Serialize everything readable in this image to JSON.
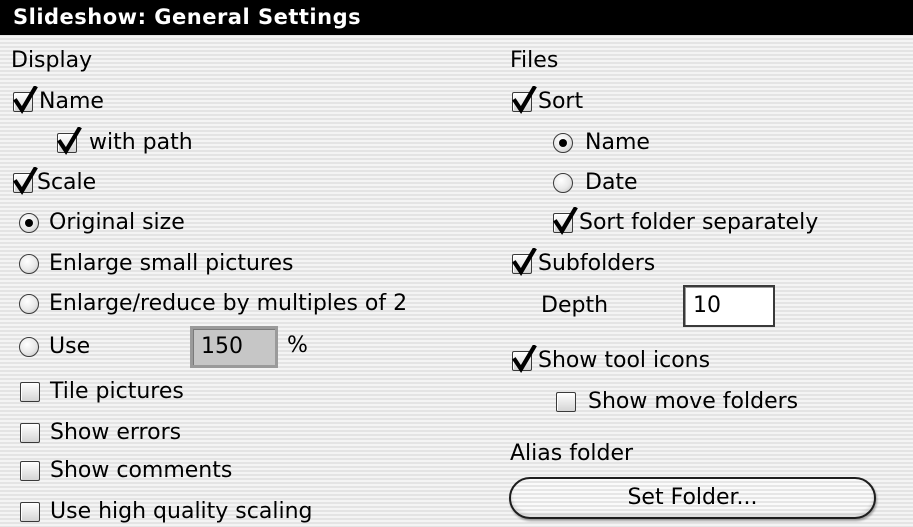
{
  "window": {
    "title": "Slideshow: General Settings"
  },
  "display": {
    "heading": "Display",
    "name": {
      "label": "Name",
      "checked": true
    },
    "with_path": {
      "label": "with path",
      "checked": true
    },
    "scale": {
      "label": "Scale",
      "checked": true
    },
    "original_size": {
      "label": "Original size",
      "selected": true
    },
    "enlarge_small": {
      "label": "Enlarge small pictures",
      "selected": false
    },
    "enlarge_reduce": {
      "label": "Enlarge/reduce by multiples of 2",
      "selected": false
    },
    "use": {
      "label": "Use",
      "selected": false,
      "value": "150",
      "unit": "%"
    },
    "tile_pictures": {
      "label": "Tile pictures",
      "checked": false
    },
    "show_errors": {
      "label": "Show errors",
      "checked": false
    },
    "show_comments": {
      "label": "Show comments",
      "checked": false
    },
    "high_quality": {
      "label": "Use high quality scaling",
      "checked": false
    }
  },
  "files": {
    "heading": "Files",
    "sort": {
      "label": "Sort",
      "checked": true
    },
    "sort_name": {
      "label": "Name",
      "selected": true
    },
    "sort_date": {
      "label": "Date",
      "selected": false
    },
    "sort_folder_separately": {
      "label": "Sort folder separately",
      "checked": true
    },
    "subfolders": {
      "label": "Subfolders",
      "checked": true
    },
    "depth": {
      "label": "Depth",
      "value": "10"
    },
    "show_tool_icons": {
      "label": "Show tool icons",
      "checked": true
    },
    "show_move_folders": {
      "label": "Show move folders",
      "checked": false
    }
  },
  "alias": {
    "heading": "Alias folder",
    "button_label": "Set Folder..."
  },
  "colors": {
    "titlebar_bg": "#000000",
    "titlebar_fg": "#ffffff",
    "panel_bg": "#ececec"
  }
}
